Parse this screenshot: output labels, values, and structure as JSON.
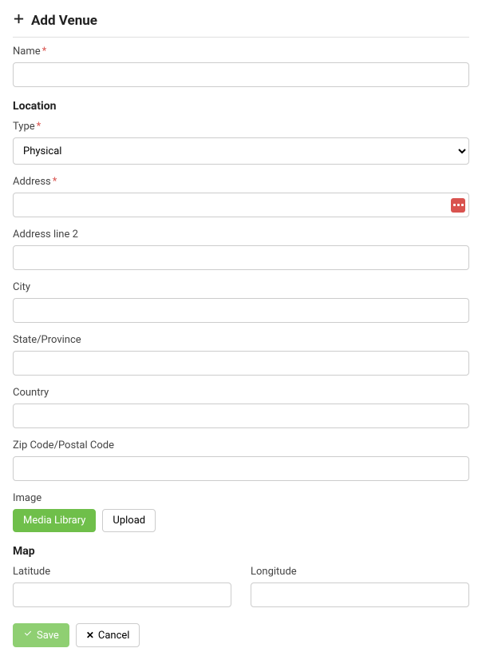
{
  "page": {
    "title": "Add Venue"
  },
  "form": {
    "name": {
      "label": "Name",
      "required": true,
      "value": ""
    },
    "location_heading": "Location",
    "type": {
      "label": "Type",
      "required": true,
      "selected": "Physical"
    },
    "address": {
      "label": "Address",
      "required": true,
      "value": ""
    },
    "address2": {
      "label": "Address line 2",
      "value": ""
    },
    "city": {
      "label": "City",
      "value": ""
    },
    "state": {
      "label": "State/Province",
      "value": ""
    },
    "country": {
      "label": "Country",
      "value": ""
    },
    "zip": {
      "label": "Zip Code/Postal Code",
      "value": ""
    },
    "image": {
      "label": "Image",
      "media_library_btn": "Media Library",
      "upload_btn": "Upload"
    },
    "map_heading": "Map",
    "latitude": {
      "label": "Latitude",
      "value": ""
    },
    "longitude": {
      "label": "Longitude",
      "value": ""
    }
  },
  "actions": {
    "save": "Save",
    "cancel": "Cancel"
  },
  "icons": {
    "plus": "plus-icon",
    "address_expand": "ellipsis-icon",
    "check": "check-icon",
    "close": "close-icon"
  }
}
